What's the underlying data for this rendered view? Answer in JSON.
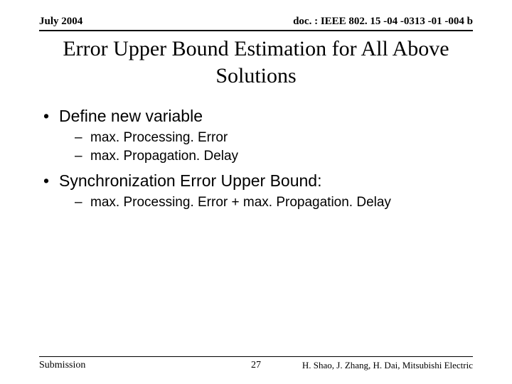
{
  "header": {
    "left": "July 2004",
    "right": "doc. : IEEE 802. 15 -04 -0313 -01 -004 b"
  },
  "title": "Error Upper Bound Estimation for All Above Solutions",
  "body": {
    "items": [
      {
        "level": 1,
        "text": "Define new variable"
      },
      {
        "level": 2,
        "text": "max. Processing. Error"
      },
      {
        "level": 2,
        "text": "max. Propagation. Delay"
      },
      {
        "level": 1,
        "text": "Synchronization Error Upper Bound:"
      },
      {
        "level": 2,
        "text": "max. Processing. Error + max. Propagation. Delay"
      }
    ]
  },
  "footer": {
    "left": "Submission",
    "center": "27",
    "right": "H. Shao, J. Zhang, H. Dai, Mitsubishi Electric"
  }
}
